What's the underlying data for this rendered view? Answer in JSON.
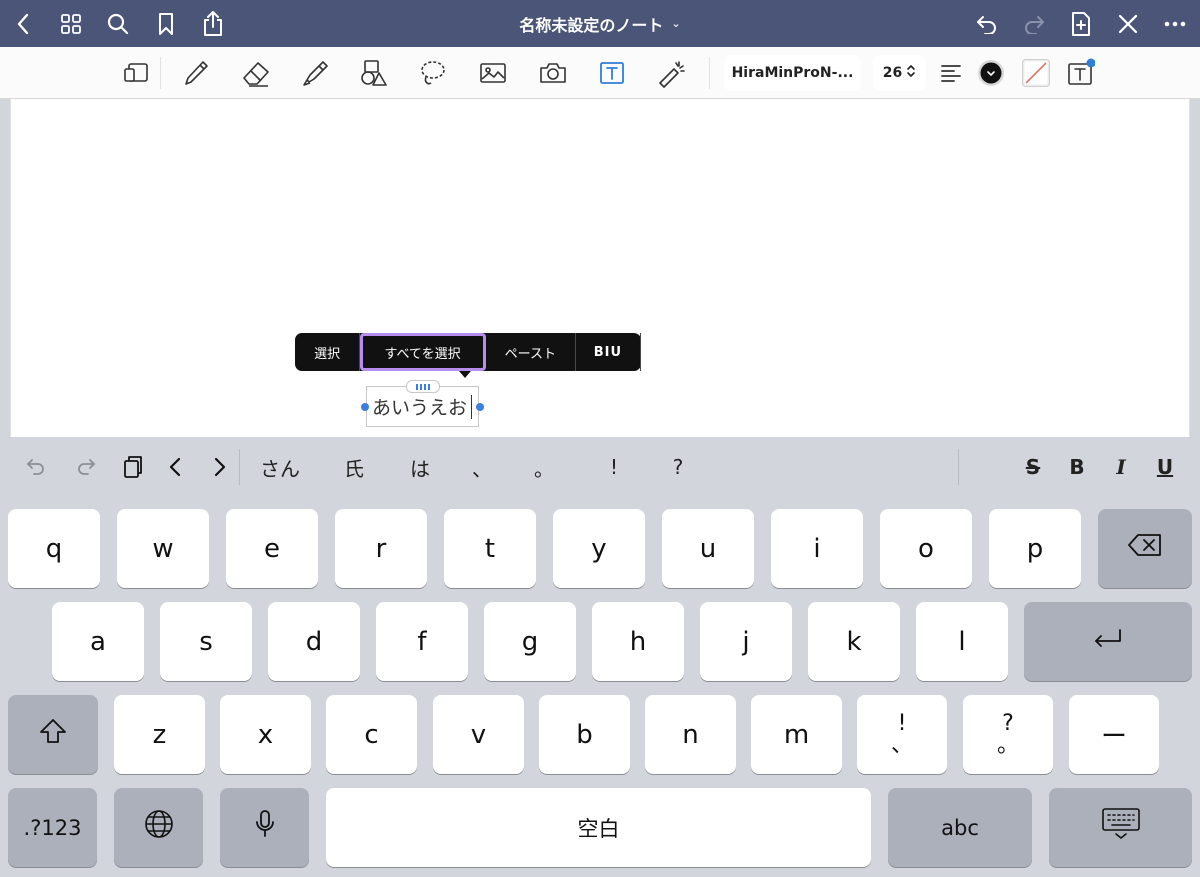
{
  "nav": {
    "title": "名称未設定のノート",
    "icons": [
      "back-chevron-icon",
      "grid-icon",
      "search-icon",
      "bookmark-icon",
      "share-icon",
      "undo-icon",
      "redo-icon",
      "add-page-icon",
      "close-icon",
      "more-icon"
    ]
  },
  "toolbar": {
    "tools": [
      "page-layout-icon",
      "pen-icon",
      "eraser-icon",
      "highlighter-icon",
      "shapes-icon",
      "lasso-icon",
      "image-icon",
      "camera-icon",
      "text-tool-icon",
      "laser-pointer-icon"
    ],
    "font_name": "HiraMinProN-...",
    "font_size": "26",
    "accent": "#3b7de0"
  },
  "popup": {
    "items": [
      "選択",
      "すべてを選択",
      "ペースト",
      "BIU"
    ],
    "selected": "すべてを選択",
    "highlight_color": "#b78ef0"
  },
  "textbox": {
    "text": "あいうえお"
  },
  "keyboard": {
    "suggestions": [
      "さん",
      "氏",
      "は",
      "、",
      "。",
      "!",
      "?"
    ],
    "format": {
      "strike": "S",
      "bold": "B",
      "italic": "I",
      "underline": "U"
    },
    "row1": [
      "q",
      "w",
      "e",
      "r",
      "t",
      "y",
      "u",
      "i",
      "o",
      "p"
    ],
    "row2": [
      "a",
      "s",
      "d",
      "f",
      "g",
      "h",
      "j",
      "k",
      "l"
    ],
    "row3": [
      "z",
      "x",
      "c",
      "v",
      "b",
      "n",
      "m"
    ],
    "punct1": [
      "!",
      "、"
    ],
    "punct2": [
      "?",
      "。"
    ],
    "dash": "ー",
    "num_key": ".?123",
    "space": "空白",
    "abc": "abc"
  }
}
